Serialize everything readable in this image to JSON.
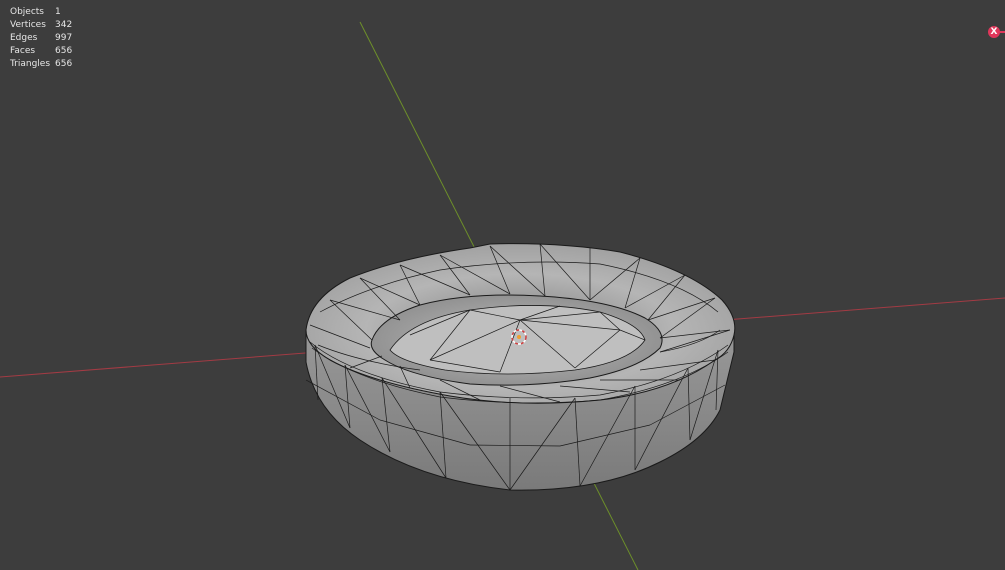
{
  "stats": [
    {
      "label": "Objects",
      "value": "1"
    },
    {
      "label": "Vertices",
      "value": "342"
    },
    {
      "label": "Edges",
      "value": "997"
    },
    {
      "label": "Faces",
      "value": "656"
    },
    {
      "label": "Triangles",
      "value": "656"
    }
  ],
  "gizmo": {
    "x_label": "X"
  },
  "colors": {
    "background": "#3d3d3d",
    "x_axis": "#a33b44",
    "y_axis": "#6d8f2a",
    "mesh_fill": "#8c8c8c",
    "mesh_wire": "#1a1a1a",
    "gizmo_x": "#e0365a"
  }
}
